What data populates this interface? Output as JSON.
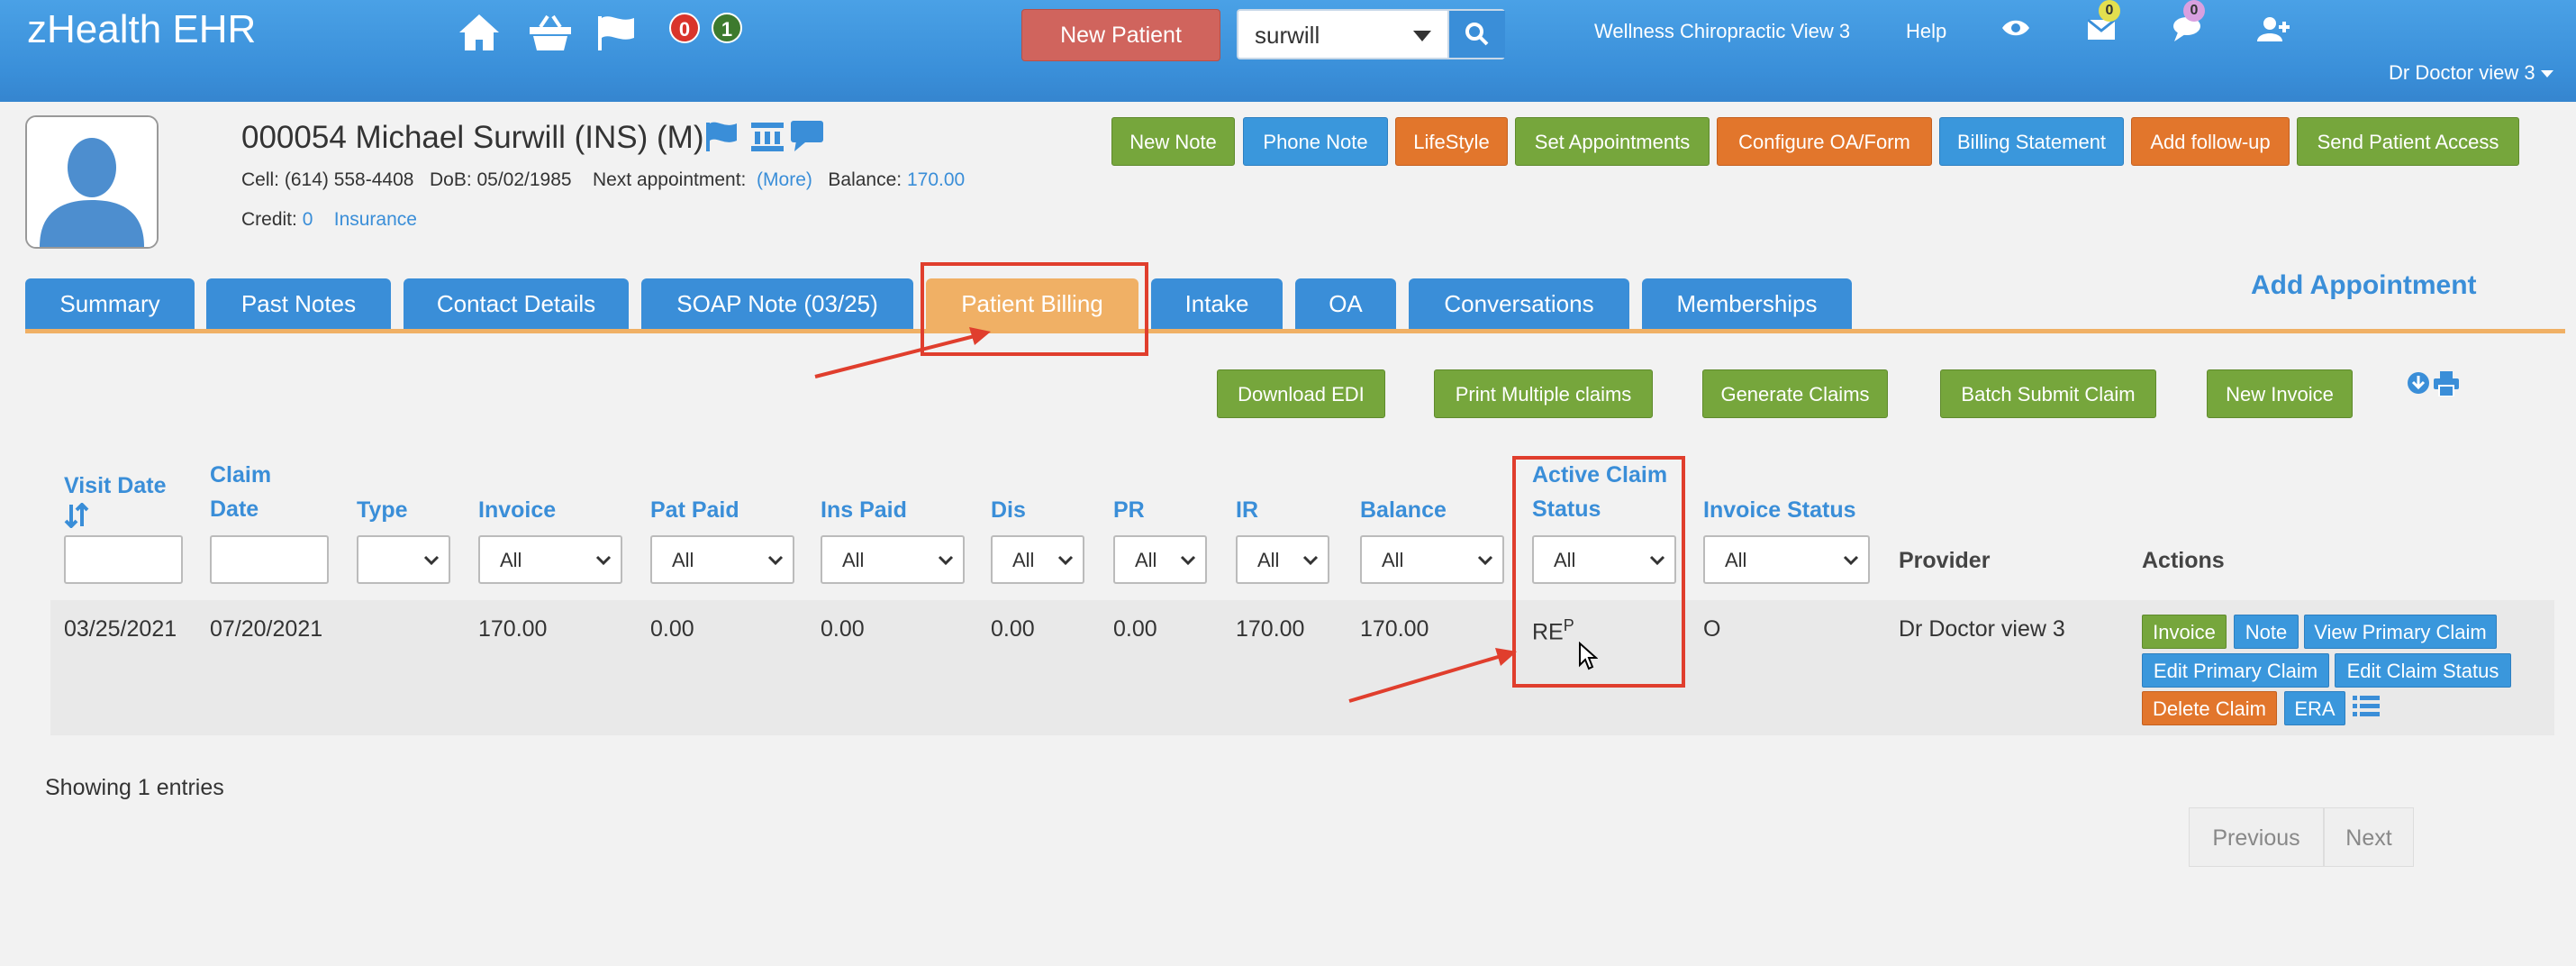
{
  "header": {
    "brand": "zHealth EHR",
    "badge_red": "0",
    "badge_green": "1",
    "new_patient": "New Patient",
    "search_value": "surwill",
    "clinic": "Wellness Chiropractic View 3",
    "help": "Help",
    "mail_count": "0",
    "chat_count": "0",
    "user": "Dr Doctor view 3"
  },
  "patient": {
    "name": "000054 Michael Surwill  (INS) (M)",
    "cell": "Cell: (614) 558-4408",
    "dob": "DoB: 05/02/1985",
    "next_appt_label": "Next appointment:",
    "more": "(More)",
    "balance_label": "Balance:",
    "balance": "170.00",
    "credit_label": "Credit:",
    "credit": "0",
    "insurance": "Insurance"
  },
  "top_buttons": [
    "New Note",
    "Phone Note",
    "LifeStyle",
    "Set Appointments",
    "Configure OA/Form",
    "Billing Statement",
    "Add follow-up",
    "Send Patient Access"
  ],
  "tabs": [
    "Summary",
    "Past Notes",
    "Contact Details",
    "SOAP Note (03/25)",
    "Patient Billing",
    "Intake",
    "OA",
    "Conversations",
    "Memberships"
  ],
  "add_appointment": "Add Appointment",
  "billing_buttons": [
    "Download EDI",
    "Print Multiple claims",
    "Generate Claims",
    "Batch Submit Claim",
    "New Invoice"
  ],
  "columns": {
    "visit_date_1": "Visit Date",
    "claim_date_1": "Claim",
    "claim_date_2": "Date",
    "type": "Type",
    "invoice": "Invoice",
    "pat_paid": "Pat Paid",
    "ins_paid": "Ins Paid",
    "dis": "Dis",
    "pr": "PR",
    "ir": "IR",
    "balance": "Balance",
    "active_claim_1": "Active Claim",
    "active_claim_2": "Status",
    "invoice_status": "Invoice Status",
    "provider": "Provider",
    "actions": "Actions"
  },
  "filters": {
    "invoice": "All",
    "pat_paid": "All",
    "ins_paid": "All",
    "dis": "All",
    "pr": "All",
    "ir": "All",
    "balance": "All",
    "active_claim": "All",
    "invoice_status": "All"
  },
  "row": {
    "visit_date": "03/25/2021",
    "claim_date": "07/20/2021",
    "invoice": "170.00",
    "pat_paid": "0.00",
    "ins_paid": "0.00",
    "dis": "0.00",
    "pr": "0.00",
    "ir": "170.00",
    "balance": "170.00",
    "claim_status": "RE",
    "claim_status_sup": "P",
    "invoice_status": "O",
    "provider": "Dr Doctor view 3"
  },
  "row_actions": [
    "Invoice",
    "Note",
    "View Primary Claim",
    "Edit Primary Claim",
    "Edit Claim Status",
    "Delete Claim",
    "ERA"
  ],
  "showing": "Showing 1 entries",
  "pager": {
    "previous": "Previous",
    "next": "Next"
  },
  "colors": {
    "header": "#3a8fd9",
    "tab": "#3a8ed8",
    "tab_active": "#f0b065",
    "green": "#76a63c",
    "orange": "#e2762c",
    "annotation": "#e03e2d"
  }
}
